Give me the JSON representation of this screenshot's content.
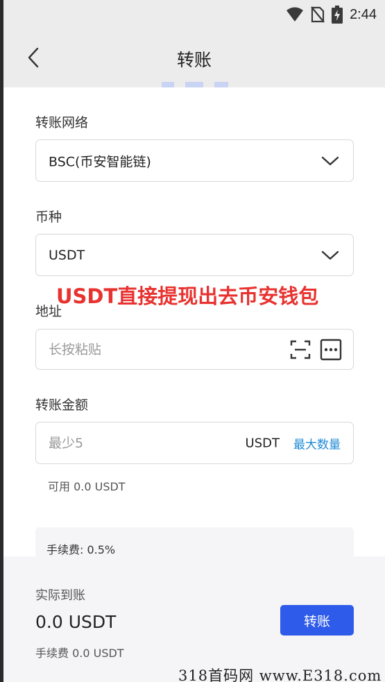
{
  "status_bar": {
    "time": "2:44",
    "icons": [
      "wifi-icon",
      "no-sim-icon",
      "battery-charging-icon"
    ]
  },
  "header": {
    "title": "转账",
    "back_icon": "back-arrow-icon"
  },
  "network": {
    "label": "转账网络",
    "value": "BSC(币安智能链)"
  },
  "currency": {
    "label": "币种",
    "value": "USDT"
  },
  "overlay_text": "USDT直接提现出去币安钱包",
  "address": {
    "label": "地址",
    "placeholder": "长按粘贴",
    "icons": [
      "scan-icon",
      "more-icon"
    ]
  },
  "amount": {
    "label": "转账金额",
    "placeholder": "最少5",
    "unit": "USDT",
    "max_label": "最大数量",
    "available": "可用 0.0 USDT"
  },
  "fee_card": {
    "text": "手续费: 0.5%"
  },
  "summary": {
    "label": "实际到账",
    "amount": "0.0 USDT",
    "fee": "手续费 0.0 USDT",
    "submit_label": "转账"
  },
  "watermark": "318首码网 www.E318.com",
  "colors": {
    "accent": "#2f5bea",
    "link": "#1f8bd6",
    "overlay_red": "#e8322f"
  }
}
